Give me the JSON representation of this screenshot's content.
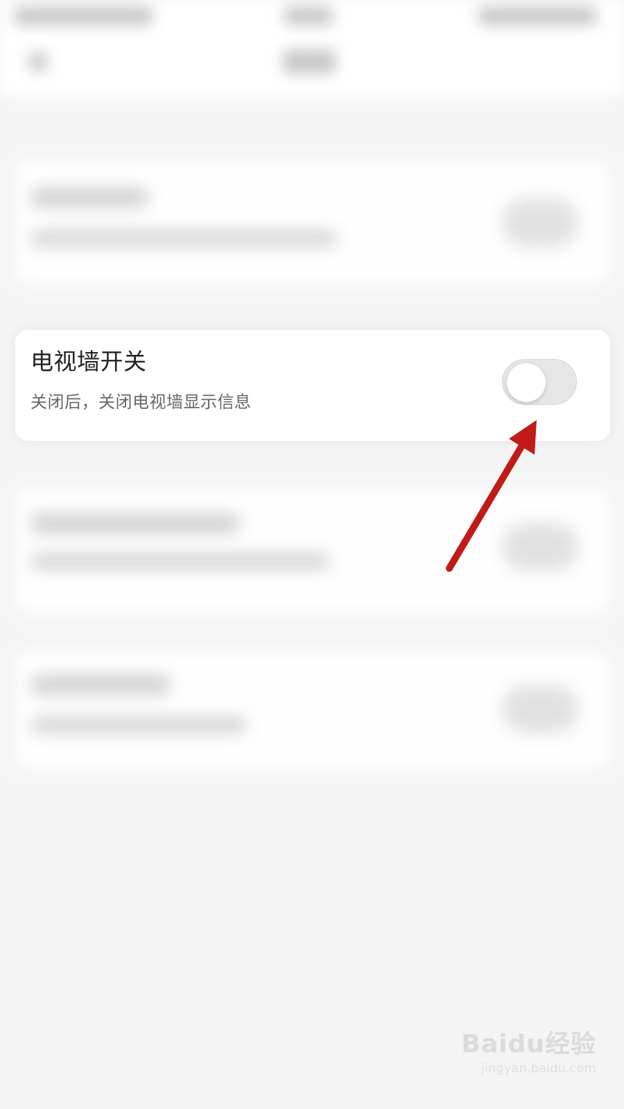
{
  "setting": {
    "title": "电视墙开关",
    "description": "关闭后，关闭电视墙显示信息",
    "toggle_on": false
  },
  "annotation": {
    "arrow_color": "#c11b17"
  },
  "watermark": {
    "brand": "Baidu经验",
    "url": "jingyan.baidu.com"
  },
  "colors": {
    "page_bg": "#f4f4f4",
    "card_bg": "#ffffff",
    "title_text": "#222222",
    "subtitle_text": "#666666",
    "toggle_track_off": "#e6e6e6",
    "toggle_knob": "#ffffff"
  }
}
